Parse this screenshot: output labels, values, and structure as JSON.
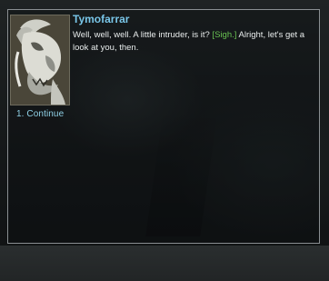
{
  "dialogue": {
    "speaker_name": "Tymofarrar",
    "line_before": "Well, well, well. A little intruder, is it? ",
    "emote": "[Sigh.]",
    "line_after": " Alright, let's get a look at you, then.",
    "speaker_portrait_icon": "dragon-portrait-icon",
    "emote_color": "#68c252",
    "name_color": "#79c6e8"
  },
  "responses": [
    {
      "label": "1. Continue"
    }
  ]
}
